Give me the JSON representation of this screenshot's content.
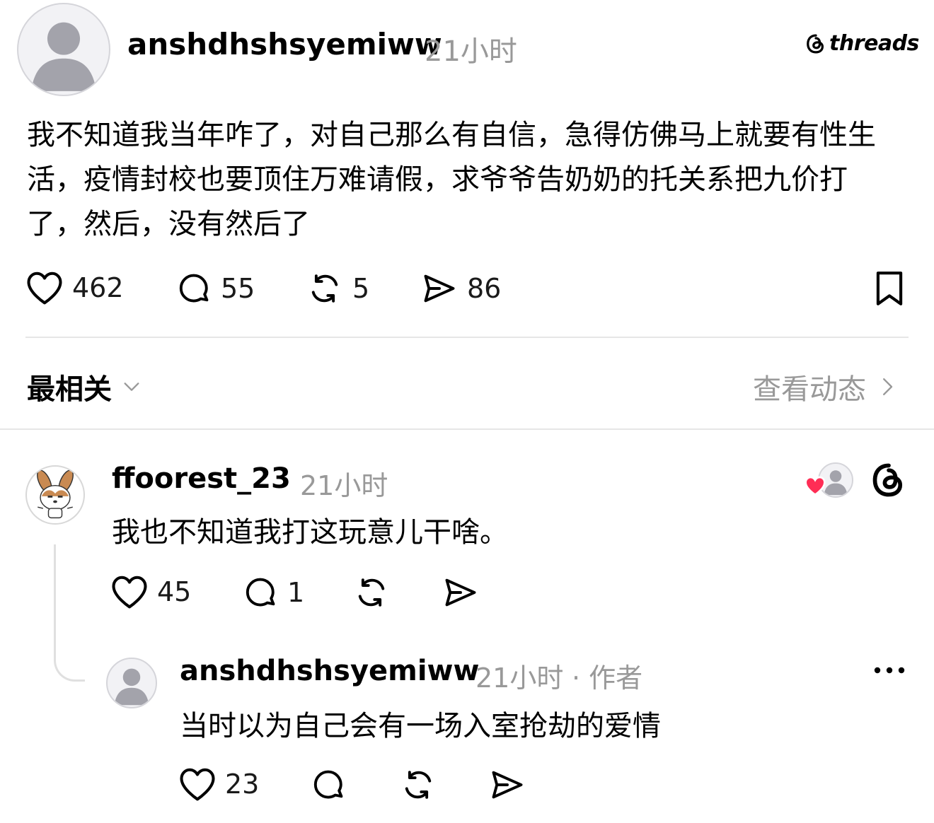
{
  "brand": {
    "logo_text": "threads"
  },
  "post": {
    "username": "anshdhshsyemiww",
    "time": "21小时",
    "text": "我不知道我当年咋了，对自己那么有自信，急得仿佛马上就要有性生活，疫情封校也要顶住万难请假，求爷爷告奶奶的托关系把九价打了，然后，没有然后了",
    "actions": {
      "likes": "462",
      "replies": "55",
      "reposts": "5",
      "shares": "86"
    }
  },
  "sort": {
    "label": "最相关",
    "view_activity": "查看动态"
  },
  "replies": [
    {
      "username": "ffoorest_23",
      "time": "21小时",
      "text": "我也不知道我打这玩意儿干啥。",
      "likes": "45",
      "replies": "1"
    },
    {
      "username": "anshdhshsyemiww",
      "time": "21小时",
      "author_tag": "· 作者",
      "text": "当时以为自己会有一场入室抢劫的爱情",
      "likes": "23"
    }
  ],
  "colors": {
    "like_red": "#ff2d55",
    "muted": "#999999",
    "divider": "#e6e6e6"
  }
}
